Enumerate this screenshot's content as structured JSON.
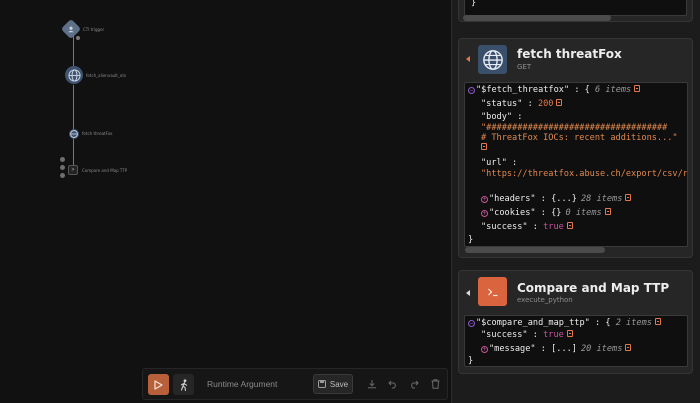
{
  "canvas": {
    "nodes": [
      {
        "label": "CTI trigger"
      },
      {
        "label": "fetch_alienvault_otx"
      },
      {
        "label": "fetch threatFox"
      },
      {
        "label": "Compare and Map TTP"
      }
    ]
  },
  "toolbar": {
    "runtime_label": "Runtime Argument",
    "save_label": "Save"
  },
  "panel": {
    "prev_brace": "}",
    "fetch_node": {
      "title": "fetch threatFox",
      "method": "GET",
      "root_key": "\"$fetch_threatfox\"",
      "root_count": "6 items",
      "status_key": "\"status\"",
      "status_value": "200",
      "body_key": "\"body\"",
      "body_value_line1": "\"###################################",
      "body_value_line2": "# ThreatFox IOCs: recent additions...\"",
      "url_key": "\"url\"",
      "url_value": "\"https://threatfox.abuse.ch/export/csv/recent/\"",
      "headers_key": "\"headers\"",
      "headers_value": "{...}",
      "headers_count": "28 items",
      "cookies_key": "\"cookies\"",
      "cookies_value": "{}",
      "cookies_count": "0 items",
      "success_key": "\"success\"",
      "success_value": "true",
      "close_brace": "}"
    },
    "compare_node": {
      "title": "Compare and Map TTP",
      "action": "execute_python",
      "root_key": "\"$compare_and_map_ttp\"",
      "root_count": "2 items",
      "success_key": "\"success\"",
      "success_value": "true",
      "message_key": "\"message\"",
      "message_value": "[...]",
      "message_count": "20 items",
      "close_brace": "}"
    }
  },
  "colors": {
    "accent_orange": "#e07a4e",
    "boolean_pink": "#c9549b",
    "edge_teal": "#4a8f7e"
  }
}
